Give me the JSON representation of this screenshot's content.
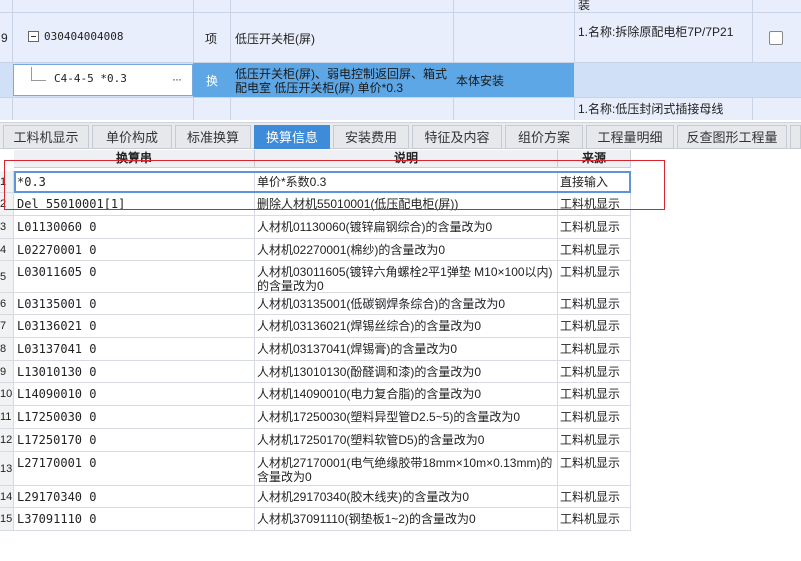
{
  "top_grid": {
    "row_partial_top": {
      "feature": "装"
    },
    "row9": {
      "num": "9",
      "code": "030404004008",
      "type": "项",
      "name": "低压开关柜(屏)",
      "feature": "1.名称:拆除原配电柜7P/7P21"
    },
    "row_sub": {
      "code": "C4-4-5 *0.3",
      "more": "···",
      "type": "换",
      "name_line1": "低压开关柜(屏)、弱电控制返回屏、箱式",
      "name_line2": "配电室 低压开关柜(屏)  单价*0.3",
      "unit_note": "本体安装"
    },
    "row_next": {
      "feature": "1.名称:低压封闭式插接母线"
    }
  },
  "tabs": [
    {
      "label": "工料机显示",
      "active": false
    },
    {
      "label": "单价构成",
      "active": false
    },
    {
      "label": "标准换算",
      "active": false
    },
    {
      "label": "换算信息",
      "active": true
    },
    {
      "label": "安装费用",
      "active": false
    },
    {
      "label": "特征及内容",
      "active": false
    },
    {
      "label": "组价方案",
      "active": false
    },
    {
      "label": "工程量明细",
      "active": false
    },
    {
      "label": "反查图形工程量",
      "active": false
    }
  ],
  "table": {
    "headers": [
      "换算串",
      "说明",
      "来源"
    ],
    "rows": [
      {
        "n": "1",
        "expr": "*0.3",
        "desc": "单价*系数0.3",
        "src": "直接输入"
      },
      {
        "n": "2",
        "expr": "Del 55010001[1]",
        "desc": "删除人材机55010001(低压配电柜(屏))",
        "src": "工料机显示"
      },
      {
        "n": "3",
        "expr": "L01130060 0",
        "desc": "人材机01130060(镀锌扁钢综合)的含量改为0",
        "src": "工料机显示"
      },
      {
        "n": "4",
        "expr": "L02270001 0",
        "desc": "人材机02270001(棉纱)的含量改为0",
        "src": "工料机显示"
      },
      {
        "n": "5",
        "expr": "L03011605 0",
        "desc": "人材机03011605(镀锌六角螺栓2平1弹垫 M10×100以内)的含量改为0",
        "src": "工料机显示"
      },
      {
        "n": "6",
        "expr": "L03135001 0",
        "desc": "人材机03135001(低碳钢焊条综合)的含量改为0",
        "src": "工料机显示"
      },
      {
        "n": "7",
        "expr": "L03136021 0",
        "desc": "人材机03136021(焊锡丝综合)的含量改为0",
        "src": "工料机显示"
      },
      {
        "n": "8",
        "expr": "L03137041 0",
        "desc": "人材机03137041(焊锡膏)的含量改为0",
        "src": "工料机显示"
      },
      {
        "n": "9",
        "expr": "L13010130 0",
        "desc": "人材机13010130(酚醛调和漆)的含量改为0",
        "src": "工料机显示"
      },
      {
        "n": "10",
        "expr": "L14090010 0",
        "desc": "人材机14090010(电力复合脂)的含量改为0",
        "src": "工料机显示"
      },
      {
        "n": "11",
        "expr": "L17250030 0",
        "desc": "人材机17250030(塑料异型管D2.5~5)的含量改为0",
        "src": "工料机显示"
      },
      {
        "n": "12",
        "expr": "L17250170 0",
        "desc": "人材机17250170(塑料软管D5)的含量改为0",
        "src": "工料机显示"
      },
      {
        "n": "13",
        "expr": "L27170001 0",
        "desc": "人材机27170001(电气绝缘胶带18mm×10m×0.13mm)的含量改为0",
        "src": "工料机显示"
      },
      {
        "n": "14",
        "expr": "L29170340 0",
        "desc": "人材机29170340(胶木线夹)的含量改为0",
        "src": "工料机显示"
      },
      {
        "n": "15",
        "expr": "L37091110 0",
        "desc": "人材机37091110(钢垫板1~2)的含量改为0",
        "src": "工料机显示"
      }
    ]
  }
}
